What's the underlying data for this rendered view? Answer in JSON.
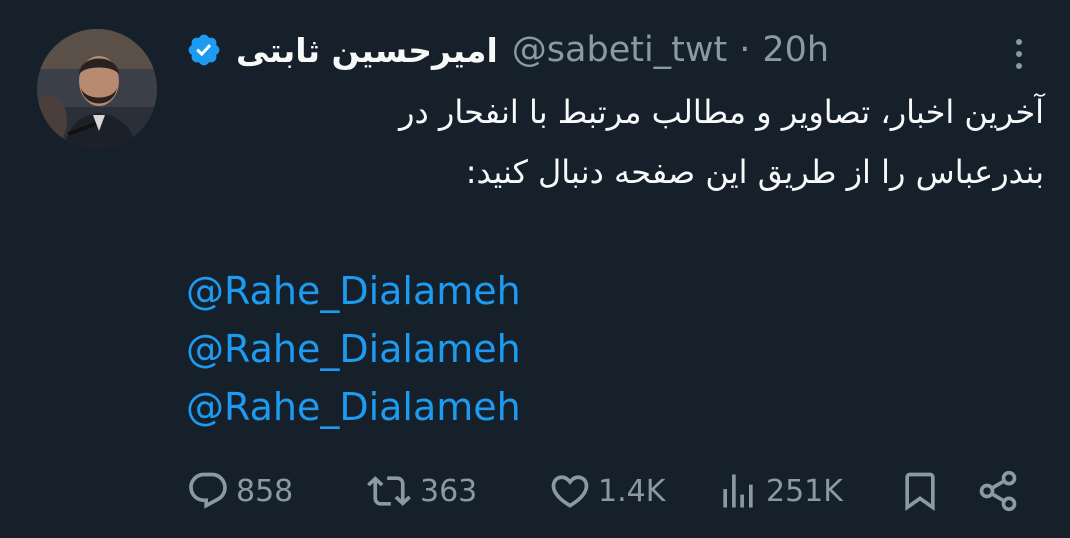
{
  "tweet": {
    "display_name": "امیرحسین ثابتی",
    "handle": "@sabeti_twt",
    "separator": "·",
    "time": "20h",
    "text_lines": [
      "آخرین اخبار، تصاویر و مطالب مرتبط با انفحار در",
      "بندرعباس را از طریق این صفحه دنبال کنید:"
    ],
    "mentions": [
      "@Rahe_Dialameh",
      "@Rahe_Dialameh",
      "@Rahe_Dialameh"
    ]
  },
  "actions": {
    "replies": "858",
    "retweets": "363",
    "likes": "1.4K",
    "views": "251K"
  },
  "icons": {
    "verified": "verified-badge-icon",
    "more": "more-options-icon",
    "reply": "reply-icon",
    "retweet": "retweet-icon",
    "like": "heart-icon",
    "views": "views-chart-icon",
    "bookmark": "bookmark-icon",
    "share": "share-icon"
  },
  "colors": {
    "background": "#15202b",
    "text": "#f7f9f9",
    "secondary": "#8b98a5",
    "link": "#1d9bf0",
    "verified": "#1d9bf0"
  }
}
